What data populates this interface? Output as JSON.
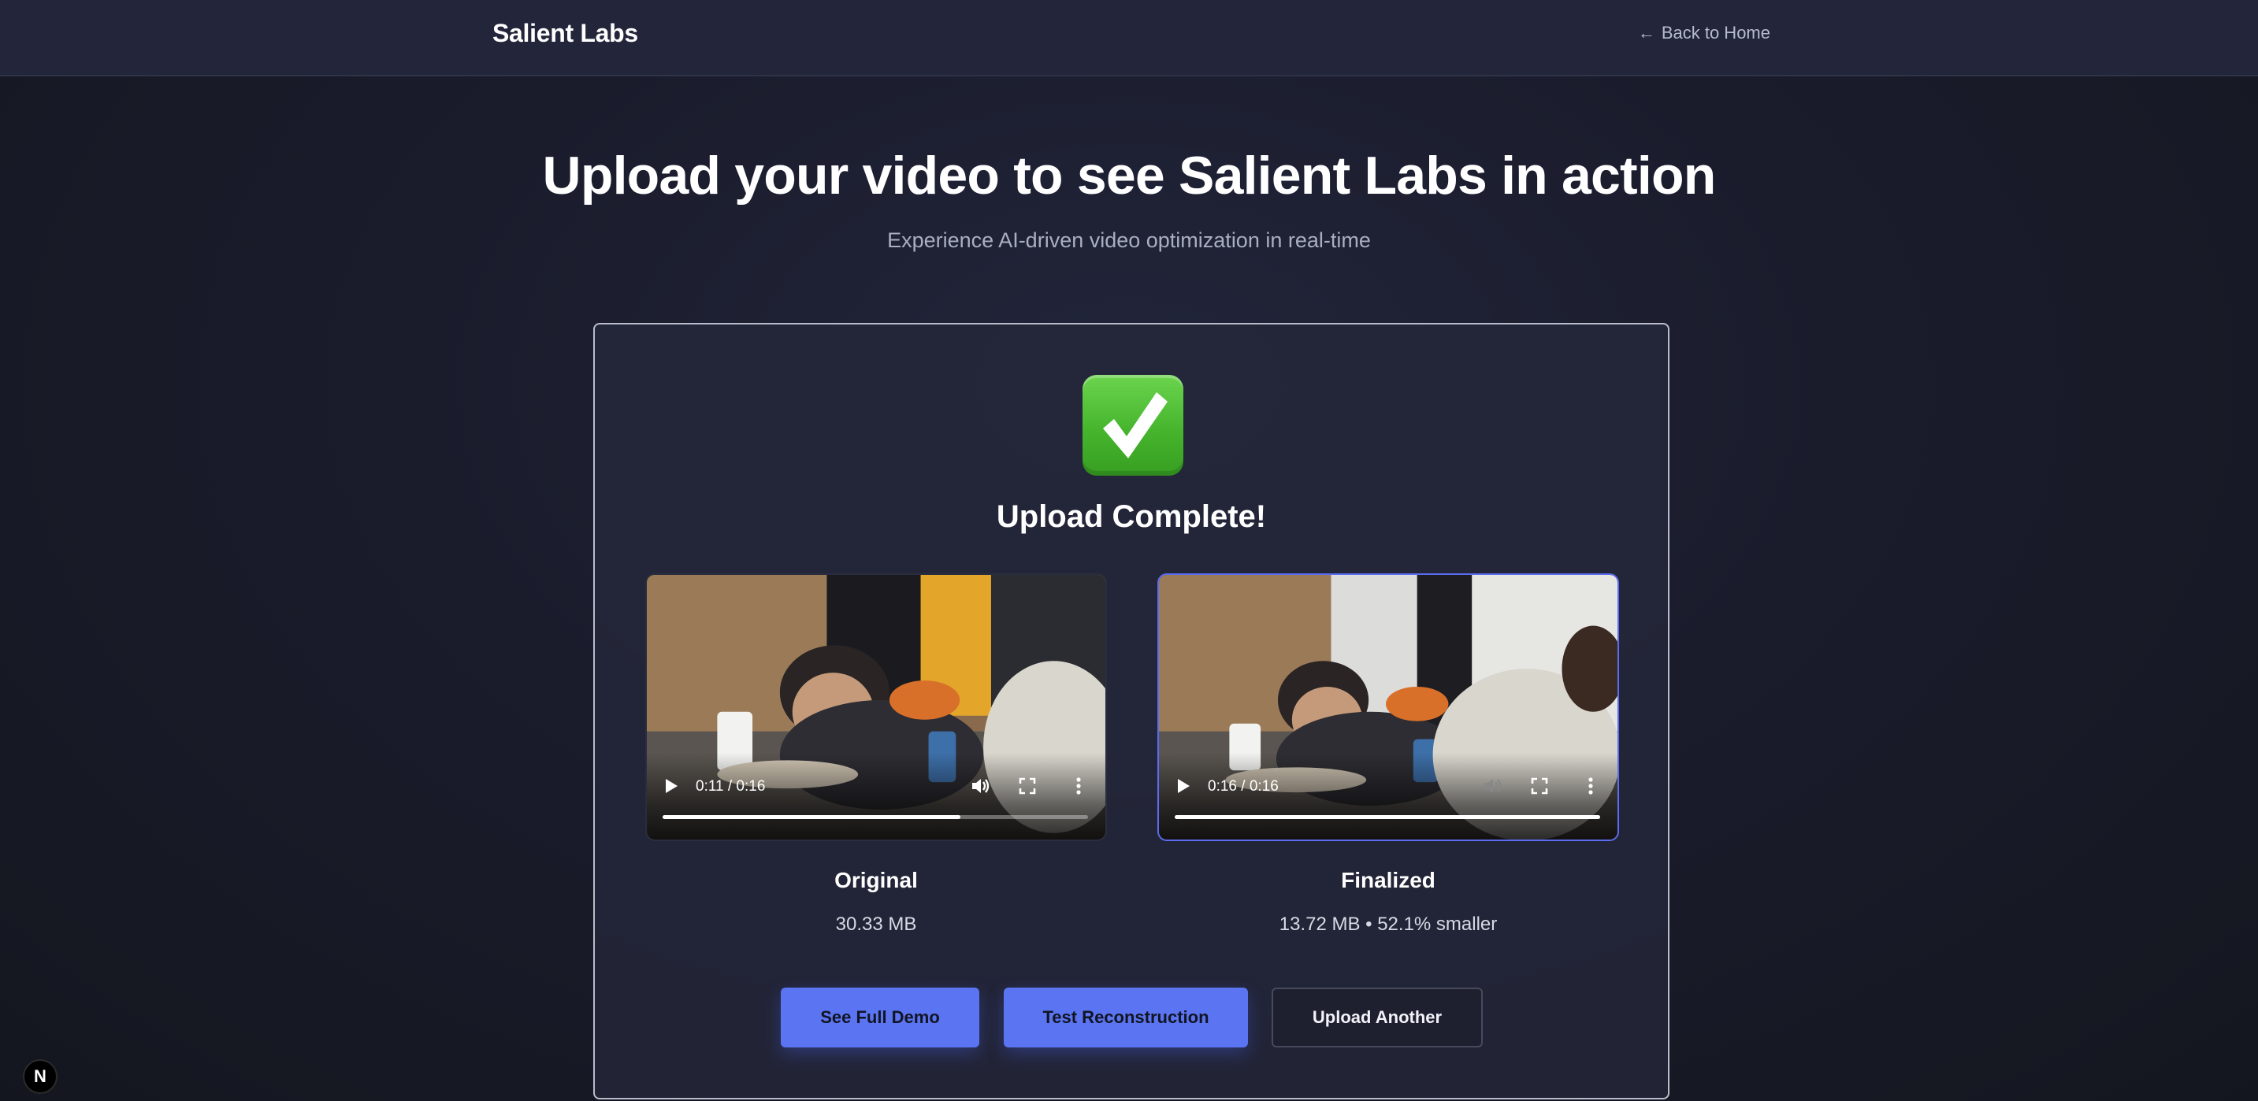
{
  "header": {
    "brand": "Salient Labs",
    "back_label": "Back to Home",
    "back_icon": "arrow-left-icon"
  },
  "hero": {
    "title": "Upload your video to see Salient Labs in action",
    "subtitle": "Experience AI-driven video optimization in real-time"
  },
  "result": {
    "status_icon": "checkmark-icon",
    "status_title": "Upload Complete!",
    "videos": [
      {
        "label": "Original",
        "size": "30.33 MB",
        "time": "0:11 / 0:16",
        "progress": 0.7
      },
      {
        "label": "Finalized",
        "size": "13.72 MB • 52.1% smaller",
        "time": "0:16 / 0:16",
        "progress": 1.0
      }
    ],
    "actions": {
      "full_demo": "See Full Demo",
      "test_reconstruction": "Test Reconstruction",
      "upload_another": "Upload Another"
    }
  },
  "dev_badge": {
    "label": "N"
  },
  "colors": {
    "accent": "#5b74f2",
    "background": "#1a1c2c",
    "header": "#23263a",
    "success": "#46b52d"
  }
}
